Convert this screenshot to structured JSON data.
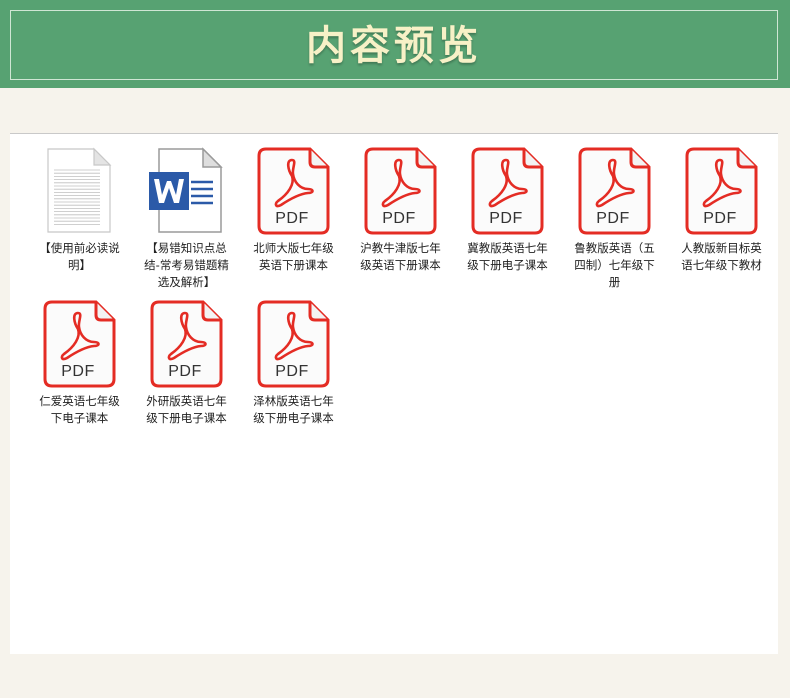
{
  "header": {
    "title": "内容预览"
  },
  "files": [
    {
      "type": "txt",
      "icon": "text-document-icon",
      "label": "【使用前必读说明】"
    },
    {
      "type": "word",
      "icon": "word-document-icon",
      "label": "【易错知识点总结-常考易错题精选及解析】"
    },
    {
      "type": "pdf",
      "icon": "pdf-icon",
      "badge": "PDF",
      "label": "北师大版七年级英语下册课本"
    },
    {
      "type": "pdf",
      "icon": "pdf-icon",
      "badge": "PDF",
      "label": "沪教牛津版七年级英语下册课本"
    },
    {
      "type": "pdf",
      "icon": "pdf-icon",
      "badge": "PDF",
      "label": "冀教版英语七年级下册电子课本"
    },
    {
      "type": "pdf",
      "icon": "pdf-icon",
      "badge": "PDF",
      "label": "鲁教版英语（五四制）七年级下册"
    },
    {
      "type": "pdf",
      "icon": "pdf-icon",
      "badge": "PDF",
      "label": "人教版新目标英语七年级下教材"
    },
    {
      "type": "pdf",
      "icon": "pdf-icon",
      "badge": "PDF",
      "label": "仁爱英语七年级下电子课本"
    },
    {
      "type": "pdf",
      "icon": "pdf-icon",
      "badge": "PDF",
      "label": "外研版英语七年级下册电子课本"
    },
    {
      "type": "pdf",
      "icon": "pdf-icon",
      "badge": "PDF",
      "label": "泽林版英语七年级下册电子课本"
    }
  ],
  "colors": {
    "header_bg": "#57a272",
    "title_text": "#f7f1c7",
    "pdf_red": "#e42c24",
    "word_blue": "#2b5aa8"
  }
}
